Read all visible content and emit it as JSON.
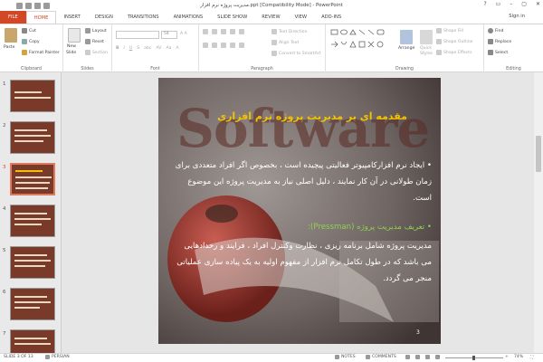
{
  "window": {
    "title": "مدیریت پروژه نرم افزار.ppt [Compatibility Mode] - PowerPoint",
    "controls": [
      "?",
      "▭",
      "–",
      "▢",
      "✕"
    ]
  },
  "tabs": [
    "FILE",
    "HOME",
    "INSERT",
    "DESIGN",
    "TRANSITIONS",
    "ANIMATIONS",
    "SLIDE SHOW",
    "REVIEW",
    "VIEW",
    "ADD-INS"
  ],
  "active_tab": "HOME",
  "signin": "Sign in",
  "ribbon": {
    "clipboard": {
      "label": "Clipboard",
      "paste": "Paste",
      "cut": "Cut",
      "copy": "Copy",
      "format_painter": "Format Painter"
    },
    "slides": {
      "label": "Slides",
      "new_slide_1": "New",
      "new_slide_2": "Slide",
      "layout": "Layout",
      "reset": "Reset",
      "section": "Section"
    },
    "font": {
      "label": "Font",
      "size": "54"
    },
    "paragraph": {
      "label": "Paragraph",
      "text_direction": "Text Direction",
      "align_text": "Align Text",
      "convert": "Convert to SmartArt"
    },
    "drawing": {
      "label": "Drawing",
      "arrange": "Arrange",
      "quick_styles_1": "Quick",
      "quick_styles_2": "Styles",
      "shape_fill": "Shape Fill",
      "shape_outline": "Shape Outline",
      "shape_effects": "Shape Effects"
    },
    "editing": {
      "label": "Editing",
      "find": "Find",
      "replace": "Replace",
      "select": "Select"
    }
  },
  "thumbnails": [
    {
      "n": "1",
      "selected": false
    },
    {
      "n": "2",
      "selected": false
    },
    {
      "n": "3",
      "selected": true
    },
    {
      "n": "4",
      "selected": false
    },
    {
      "n": "5",
      "selected": false
    },
    {
      "n": "6",
      "selected": false
    },
    {
      "n": "7",
      "selected": false
    }
  ],
  "slide": {
    "title": "مقدمه ای بر مدیریت پروژه نرم افزاری",
    "bg_word": "Software",
    "p1": "• ایجاد نرم افزارکامپیوتر فعالیتی پیچیده است ، بخصوص اگر افراد متعددی برای زمان طولانی در آن کار نمایند ، دلیل اصلی نیاز به مدیریت پروژه این موضوع است.",
    "p2_head": "• تعریف مدیریت پروژه (Pressman):",
    "p2": "مدیریت پروژه شامل برنامه ریزی ، نظارت وکنترل افراد ، فرایند و رخدادهایی می باشد که در طول تکامل نرم افزار از مفهوم اولیه به یک پیاده سازی عملیاتی منجر می گردد.",
    "number": "3",
    "colors": {
      "title": "#f2c200",
      "body": "#ffffff",
      "highlight": "#8fd14f"
    }
  },
  "status": {
    "slide": "SLIDE 3 OF 13",
    "language": "PERSIAN",
    "notes": "NOTES",
    "comments": "COMMENTS",
    "zoom": "74%",
    "zoom_minus": "–",
    "zoom_plus": "+"
  }
}
